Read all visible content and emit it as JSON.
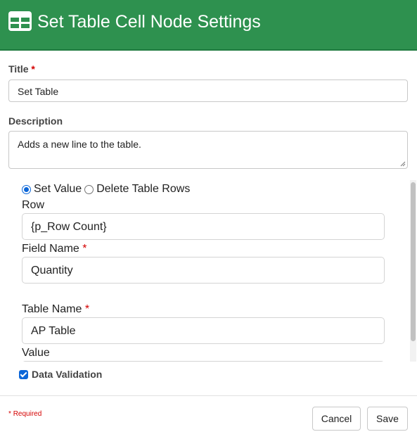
{
  "header": {
    "title": "Set Table Cell Node Settings",
    "icon": "table-icon",
    "background": "#2e914f"
  },
  "form": {
    "title_label": "Title",
    "title_value": "Set Table",
    "description_label": "Description",
    "description_value": "Adds a new line to the table.",
    "required_mark": "*"
  },
  "panel": {
    "mode_options": [
      {
        "label": "Set Value",
        "selected": true
      },
      {
        "label": "Delete Table Rows",
        "selected": false
      }
    ],
    "row_label": "Row",
    "row_value": "{p_Row Count}",
    "field_name_label": "Field Name",
    "field_name_value": "Quantity",
    "table_name_label": "Table Name",
    "table_name_value": "AP Table",
    "value_label": "Value"
  },
  "data_validation": {
    "label": "Data Validation",
    "checked": true
  },
  "footer": {
    "required_note": "Required",
    "cancel_label": "Cancel",
    "save_label": "Save"
  }
}
